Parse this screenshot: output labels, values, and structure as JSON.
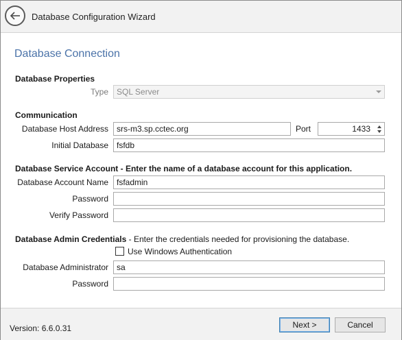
{
  "window": {
    "title": "Database Configuration Wizard"
  },
  "page": {
    "section_title": "Database Connection"
  },
  "database_properties": {
    "heading": "Database Properties",
    "type_label": "Type",
    "type_value": "SQL Server"
  },
  "communication": {
    "heading": "Communication",
    "host_label": "Database Host Address",
    "host_value": "srs-m3.sp.cctec.org",
    "port_label": "Port",
    "port_value": "1433",
    "initial_db_label": "Initial Database",
    "initial_db_value": "fsfdb"
  },
  "service_account": {
    "heading": "Database Service Account",
    "description": " - Enter the name of a database account for this application.",
    "account_label": "Database Account Name",
    "account_value": "fsfadmin",
    "password_label": "Password",
    "password_value": "",
    "verify_label": "Verify Password",
    "verify_value": ""
  },
  "admin_credentials": {
    "heading": "Database Admin Credentials",
    "description": " - Enter the credentials needed for provisioning the database.",
    "windows_auth_label": "Use Windows Authentication",
    "windows_auth_checked": false,
    "admin_label": "Database Administrator",
    "admin_value": "sa",
    "password_label": "Password",
    "password_value": ""
  },
  "footer": {
    "version": "Version: 6.6.0.31",
    "next_label": "Next >",
    "cancel_label": "Cancel"
  },
  "colors": {
    "section_title": "#4a72a8",
    "chrome": "#f2f2f2",
    "primary_border": "#3c7fb1"
  },
  "icons": {
    "back": "back-arrow-icon",
    "combo": "chevron-down-icon",
    "spin_up": "spin-up-icon",
    "spin_down": "spin-down-icon"
  }
}
